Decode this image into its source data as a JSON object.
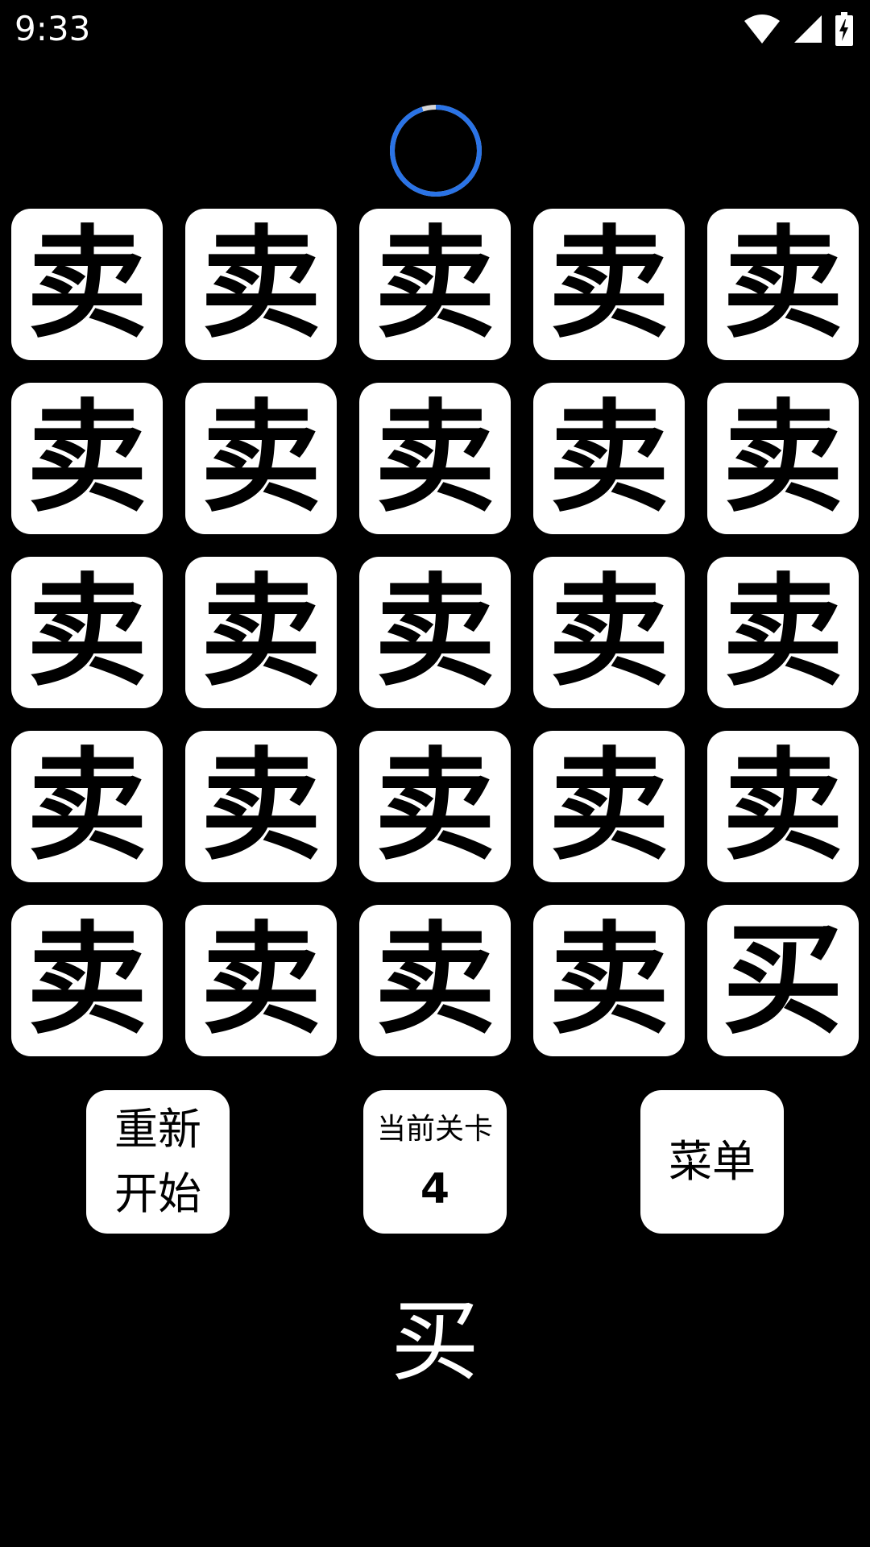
{
  "status_bar": {
    "time": "9:33",
    "icons": [
      "wifi-icon",
      "cellular-signal-icon",
      "battery-charging-icon"
    ]
  },
  "timer": {
    "progress": 0.95,
    "accent_color": "#2a73e6",
    "track_color": "#d6d6d6"
  },
  "grid": {
    "rows": 5,
    "cols": 5,
    "tiles": [
      "卖",
      "卖",
      "卖",
      "卖",
      "卖",
      "卖",
      "卖",
      "卖",
      "卖",
      "卖",
      "卖",
      "卖",
      "卖",
      "卖",
      "卖",
      "卖",
      "卖",
      "卖",
      "卖",
      "卖",
      "卖",
      "卖",
      "卖",
      "卖",
      "买"
    ]
  },
  "buttons": {
    "restart_line1": "重新",
    "restart_line2": "开始",
    "level_label": "当前关卡",
    "level_number": "4",
    "menu_label": "菜单"
  },
  "target": {
    "char": "买"
  }
}
